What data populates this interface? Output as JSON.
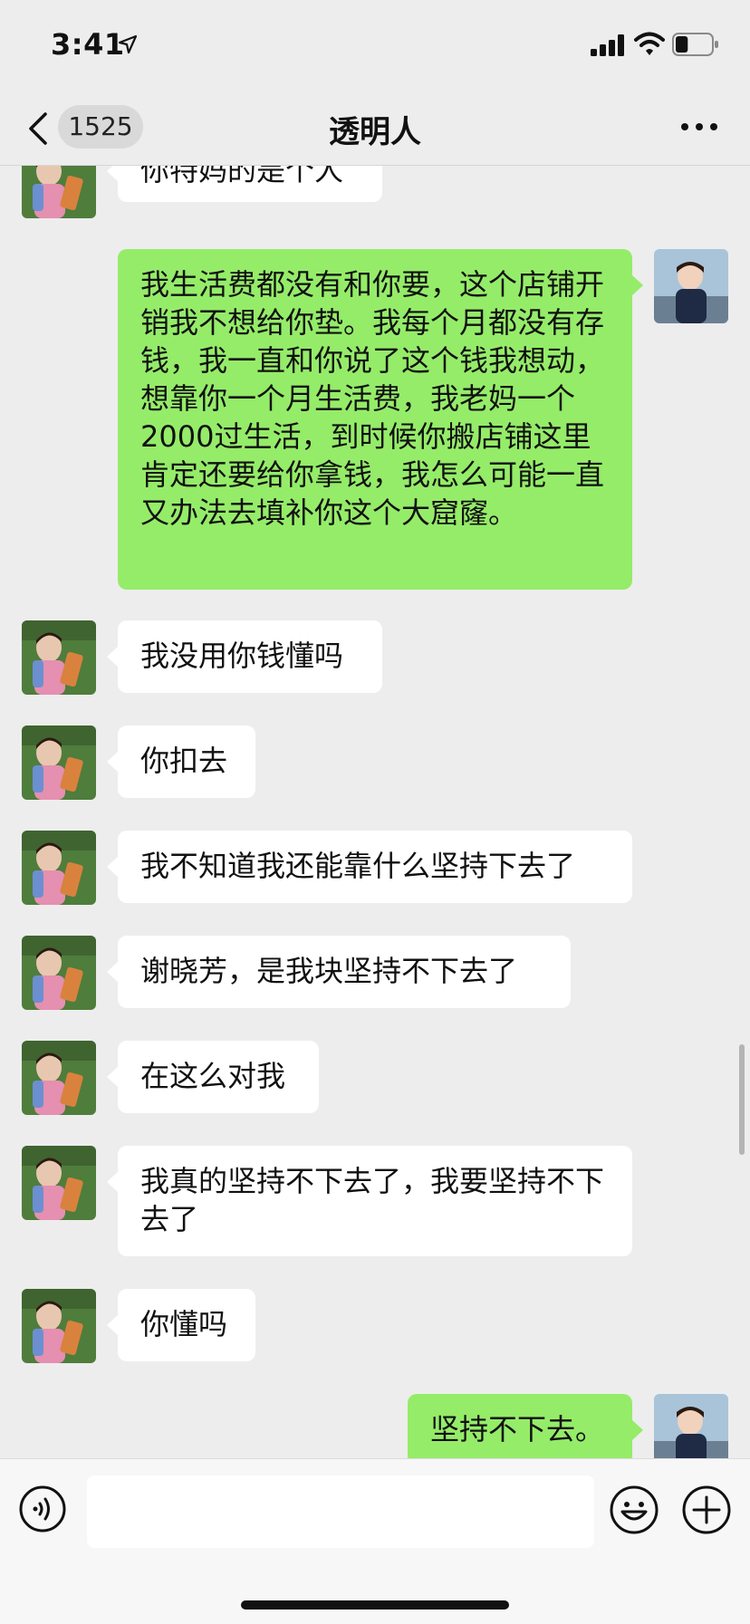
{
  "status_bar": {
    "time": "3:41",
    "battery_level": 0.35
  },
  "nav": {
    "back_count": "1525",
    "title": "透明人",
    "more_icon": "more-dots-icon"
  },
  "messages": [
    {
      "side": "in",
      "text": "你特妈的是个人"
    },
    {
      "side": "out",
      "text": "我生活费都没有和你要，这个店铺开销我不想给你垫。我每个月都没有存钱，我一直和你说了这个钱我想动，想靠你一个月生活费，我老妈一个2000过生活，到时候你搬店铺这里肯定还要给你拿钱，我怎么可能一直又办法去填补你这个大窟窿。"
    },
    {
      "side": "in",
      "text": "我没用你钱懂吗"
    },
    {
      "side": "in",
      "text": "你扣去"
    },
    {
      "side": "in",
      "text": "我不知道我还能靠什么坚持下去了"
    },
    {
      "side": "in",
      "text": "谢晓芳，是我块坚持不下去了"
    },
    {
      "side": "in",
      "text": "在这么对我"
    },
    {
      "side": "in",
      "text": "我真的坚持不下去了，我要坚持不下去了"
    },
    {
      "side": "in",
      "text": "你懂吗"
    },
    {
      "side": "out",
      "text": "坚持不下去。"
    }
  ],
  "input_bar": {
    "text": "",
    "icons": [
      "voice-icon",
      "emoji-icon",
      "plus-icon"
    ]
  },
  "colors": {
    "background": "#ededed",
    "incoming_bubble": "#ffffff",
    "outgoing_bubble": "#95ec69"
  }
}
